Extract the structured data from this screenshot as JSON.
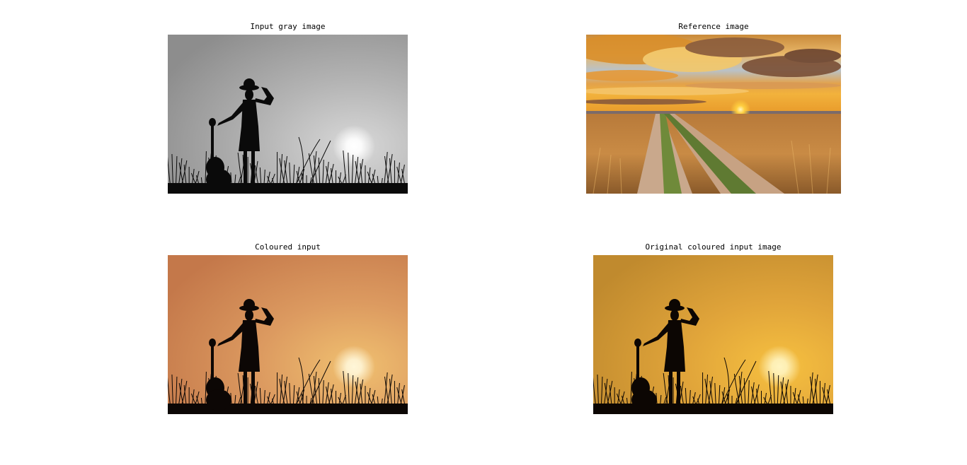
{
  "panels": [
    {
      "title": "Input gray image",
      "sky_top": "#8d8d8d",
      "sky_mid": "#b4b4b4",
      "sky_low": "#d8d8d8",
      "sun": "#ffffff",
      "silhouette": "#0a0a0a"
    },
    {
      "title": "Reference image"
    },
    {
      "title": "Coloured input",
      "sky_top": "#c4784a",
      "sky_mid": "#dc9a60",
      "sky_low": "#f0c070",
      "sun": "#fff6d8",
      "silhouette": "#0c0705"
    },
    {
      "title": "Original coloured input image",
      "sky_top": "#c08a2e",
      "sky_mid": "#e0a43a",
      "sky_low": "#f6c040",
      "sun": "#fff4c0",
      "silhouette": "#0c0603"
    }
  ],
  "icons": [
    "silhouette-figure-icon",
    "guitar-icon",
    "sun-icon",
    "grass-icon",
    "dirt-road-icon",
    "clouds-icon"
  ]
}
